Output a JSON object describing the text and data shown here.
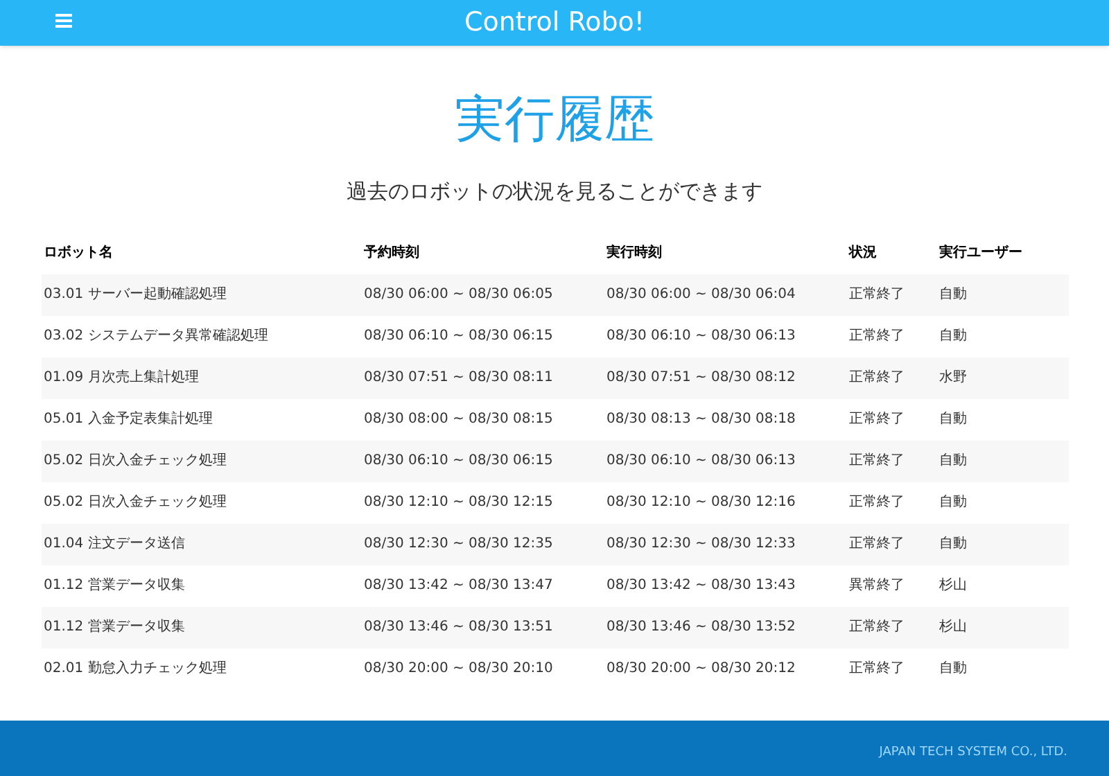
{
  "header": {
    "title": "Control Robo!"
  },
  "page": {
    "title": "実行履歴",
    "subtitle": "過去のロボットの状況を見ることができます"
  },
  "table": {
    "columns": [
      "ロボット名",
      "予約時刻",
      "実行時刻",
      "状況",
      "実行ユーザー"
    ],
    "rows": [
      [
        "03.01 サーバー起動確認処理",
        "08/30 06:00 ~ 08/30 06:05",
        "08/30 06:00 ~ 08/30 06:04",
        "正常終了",
        "自動"
      ],
      [
        "03.02 システムデータ異常確認処理",
        "08/30 06:10 ~ 08/30 06:15",
        "08/30 06:10 ~ 08/30 06:13",
        "正常終了",
        "自動"
      ],
      [
        "01.09 月次売上集計処理",
        "08/30 07:51 ~ 08/30 08:11",
        "08/30 07:51 ~ 08/30 08:12",
        "正常終了",
        "水野"
      ],
      [
        "05.01 入金予定表集計処理",
        "08/30 08:00 ~ 08/30 08:15",
        "08/30 08:13 ~ 08/30 08:18",
        "正常終了",
        "自動"
      ],
      [
        "05.02 日次入金チェック処理",
        "08/30 06:10 ~ 08/30 06:15",
        "08/30 06:10 ~ 08/30 06:13",
        "正常終了",
        "自動"
      ],
      [
        "05.02 日次入金チェック処理",
        "08/30 12:10 ~ 08/30 12:15",
        "08/30 12:10 ~ 08/30 12:16",
        "正常終了",
        "自動"
      ],
      [
        "01.04 注文データ送信",
        "08/30 12:30 ~ 08/30 12:35",
        "08/30 12:30 ~ 08/30 12:33",
        "正常終了",
        "自動"
      ],
      [
        "01.12 営業データ収集",
        "08/30 13:42 ~ 08/30 13:47",
        "08/30 13:42 ~ 08/30 13:43",
        "異常終了",
        "杉山"
      ],
      [
        "01.12 営業データ収集",
        "08/30 13:46 ~ 08/30 13:51",
        "08/30 13:46 ~ 08/30 13:52",
        "正常終了",
        "杉山"
      ],
      [
        "02.01 勤怠入力チェック処理",
        "08/30 20:00 ~ 08/30 20:10",
        "08/30 20:00 ~ 08/30 20:12",
        "正常終了",
        "自動"
      ]
    ]
  },
  "footer": {
    "company": "JAPAN TECH SYSTEM CO., LTD."
  }
}
